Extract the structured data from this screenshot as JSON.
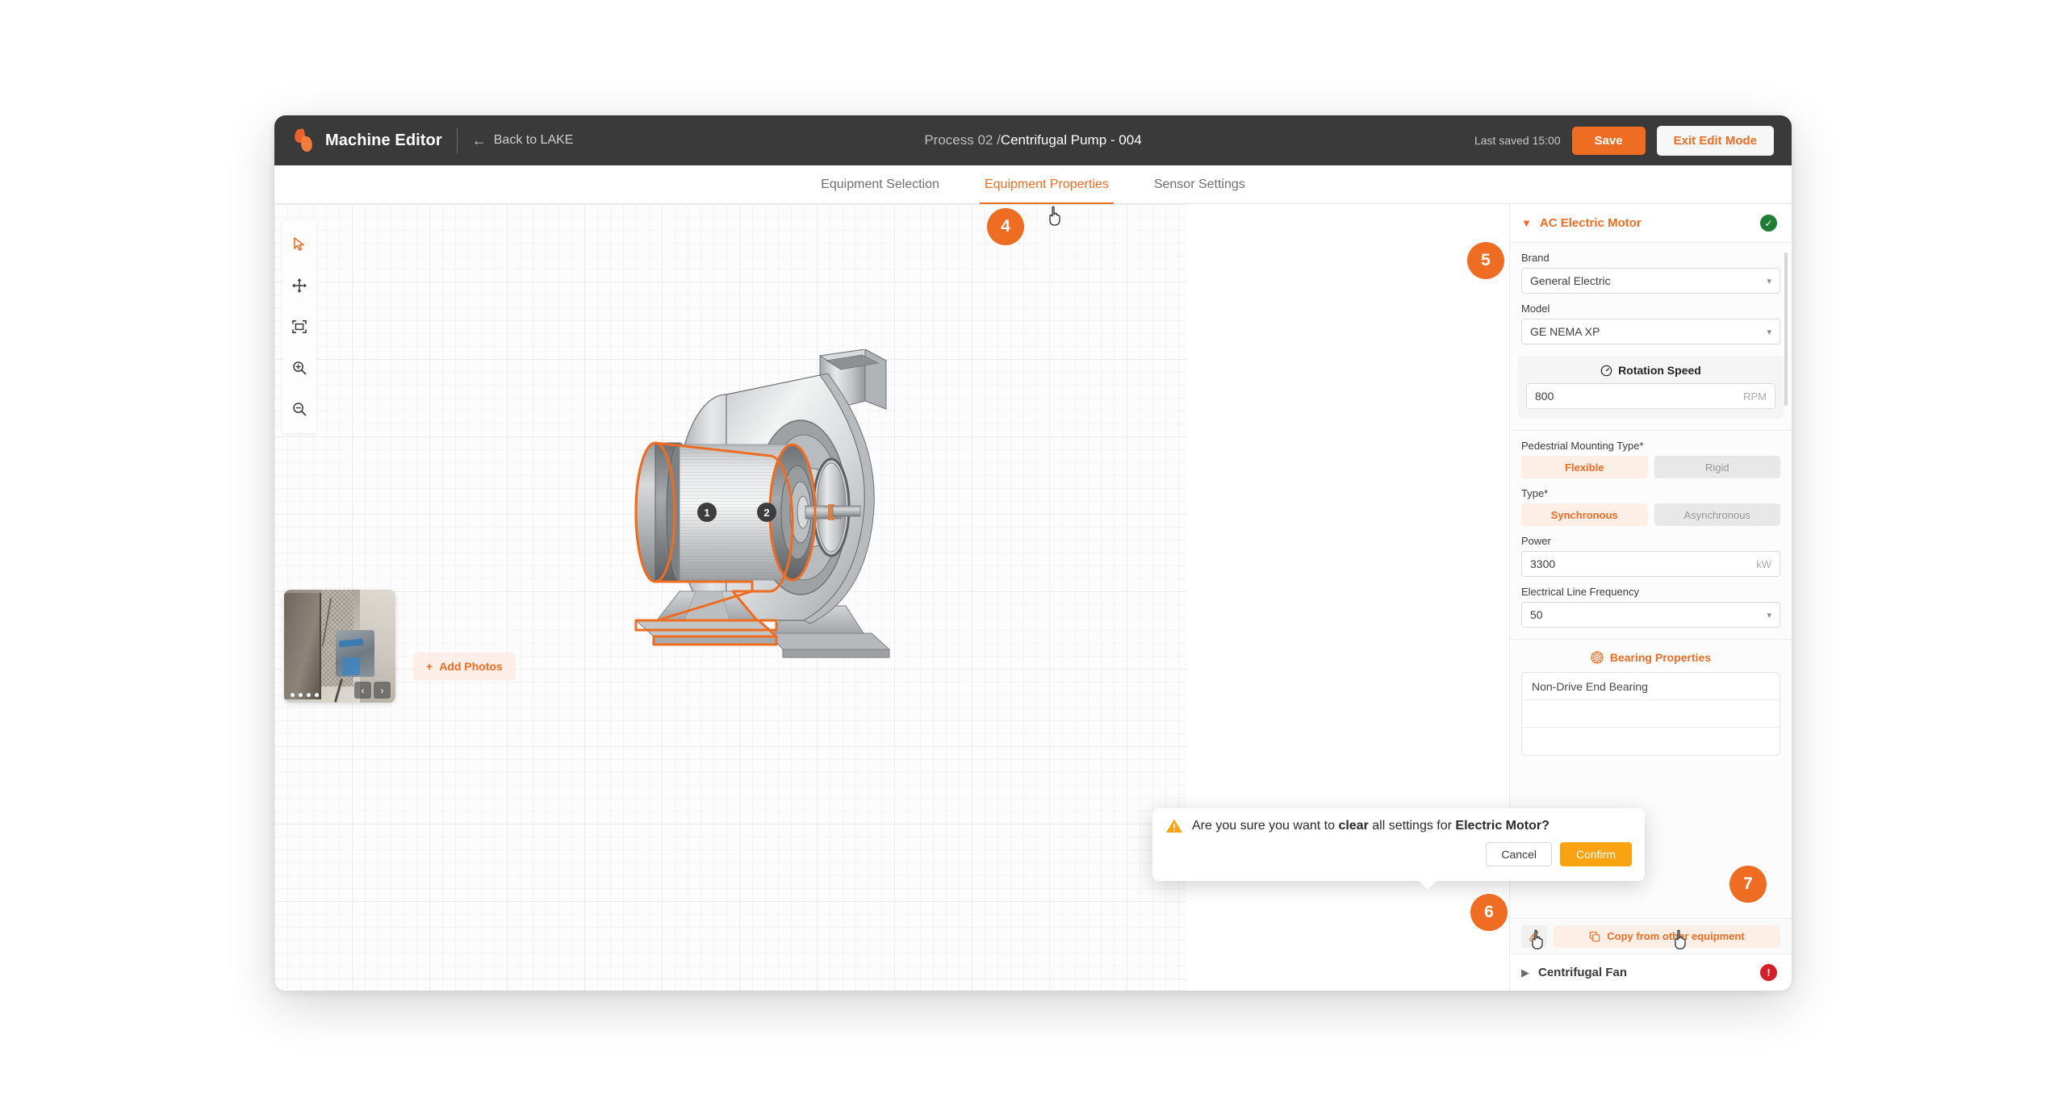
{
  "topbar": {
    "brand": "Machine Editor",
    "back_label": "Back to LAKE",
    "back_icon": "arrow-left-icon",
    "breadcrumb_prefix": "Process 02 / ",
    "breadcrumb_current": "Centrifugal Pump - 004",
    "last_saved": "Last saved 15:00",
    "save_label": "Save",
    "exit_label": "Exit Edit Mode"
  },
  "tabs": [
    {
      "label": "Equipment Selection",
      "active": false
    },
    {
      "label": "Equipment Properties",
      "active": true
    },
    {
      "label": "Sensor Settings",
      "active": false
    }
  ],
  "toolbar": {
    "items": [
      {
        "icon": "cursor-select-icon",
        "active": true
      },
      {
        "icon": "move-pan-icon",
        "active": false
      },
      {
        "icon": "fit-to-screen-icon",
        "active": false
      },
      {
        "icon": "zoom-in-icon",
        "active": false
      },
      {
        "icon": "zoom-out-icon",
        "active": false
      }
    ]
  },
  "canvas": {
    "motor_markers": [
      "1",
      "2"
    ],
    "photos": {
      "dots": 4,
      "prev_label": "‹",
      "next_label": "›",
      "add_photos_label": "Add Photos",
      "add_photos_icon": "plus-icon"
    }
  },
  "panel": {
    "title": "AC Electric Motor",
    "collapse_icon": "chevron-down-icon",
    "status_icon": "check-circle-icon",
    "brand_label": "Brand",
    "brand_value": "General Electric",
    "model_label": "Model",
    "model_value": "GE NEMA XP",
    "rotation_title": "Rotation Speed",
    "rotation_icon": "gauge-icon",
    "rotation_value": "800",
    "rotation_unit": "RPM",
    "mounting_label": "Pedestrial Mounting Type*",
    "mounting_options": [
      "Flexible",
      "Rigid"
    ],
    "mounting_selected": "Flexible",
    "type_label": "Type*",
    "type_options": [
      "Synchronous",
      "Asynchronous"
    ],
    "type_selected": "Synchronous",
    "power_label": "Power",
    "power_value": "3300",
    "power_unit": "kW",
    "frequency_label": "Electrical Line Frequency",
    "frequency_value": "50",
    "bearing_title": "Bearing Properties",
    "bearing_icon": "bearing-icon",
    "bearing_rows": [
      "Non-Drive End Bearing",
      "",
      ""
    ],
    "clear_icon": "broom-icon",
    "copy_label": "Copy from other equipment",
    "copy_icon": "copy-icon"
  },
  "fan_section": {
    "title": "Centrifugal Fan",
    "expand_icon": "chevron-right-icon",
    "status_icon": "error-circle-icon"
  },
  "confirm_dialog": {
    "warning_icon": "warning-triangle-icon",
    "msg_part1": "Are you sure you want to ",
    "msg_strong1": "clear",
    "msg_part2": " all settings for ",
    "msg_strong2": "Electric Motor?",
    "cancel_label": "Cancel",
    "confirm_label": "Confirm"
  },
  "steps": [
    {
      "number": "4"
    },
    {
      "number": "5"
    },
    {
      "number": "6"
    },
    {
      "number": "7"
    }
  ],
  "colors": {
    "accent": "#ef6c23",
    "accent_soft": "#fdeee6",
    "topbar_bg": "#3a3a3a",
    "confirm_yellow": "#f9a312",
    "success_green": "#1e7e34",
    "error_red": "#d32029"
  }
}
